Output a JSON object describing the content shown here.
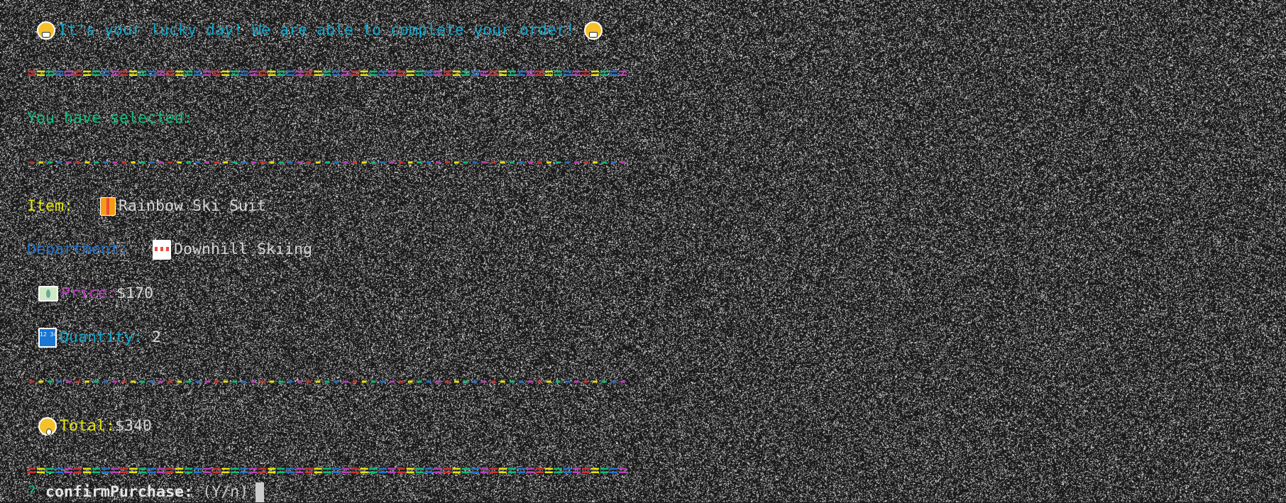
{
  "header": {
    "text": "It's your lucky day! We are able to complete your order! ",
    "icon_left": "grinning-face-icon",
    "icon_right": "grinning-face-icon"
  },
  "rainbow": {
    "double": "=================================================================",
    "single": "-----------------------------------------------------------------",
    "colors": [
      "#cd3131",
      "#e5e510",
      "#0dbc79",
      "#2472c8",
      "#bc3fbc"
    ]
  },
  "selected_label": "You have selected:",
  "item": {
    "label": "Item:",
    "icon": "gift-icon",
    "value": "Rainbow Ski Suit"
  },
  "department": {
    "label": "Department:",
    "icon": "store-icon",
    "value": "Downhill Skiing"
  },
  "price": {
    "icon": "money-icon",
    "label": "Price:",
    "value": "$170"
  },
  "quantity": {
    "icon": "input-numbers-icon",
    "label": "Quantity:",
    "value": "2",
    "icon_text": "12 34"
  },
  "total": {
    "icon": "astonished-face-icon",
    "label": "Total:",
    "value": "$340"
  },
  "prompt": {
    "marker": "?",
    "name": "confirmPurchase:",
    "hint": "(Y/n)"
  }
}
